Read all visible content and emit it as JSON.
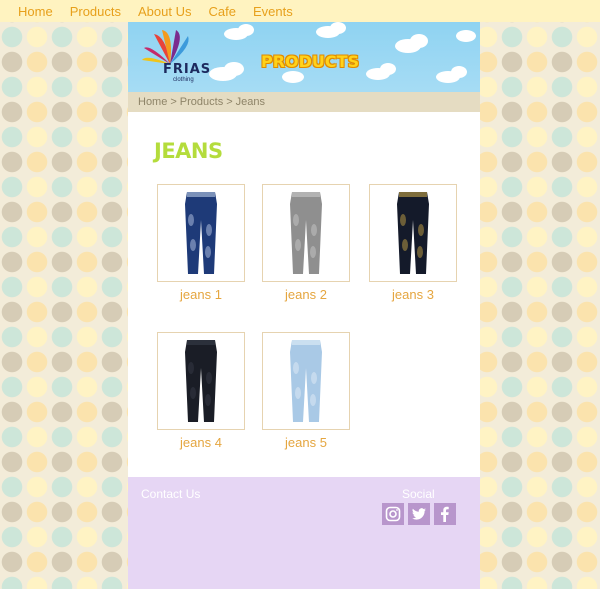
{
  "nav": [
    "Home",
    "Products",
    "About Us",
    "Cafe",
    "Events"
  ],
  "banner": {
    "logo_text": "FRIAS",
    "logo_sub": "clothing",
    "title": "PRODUCTS"
  },
  "breadcrumb": [
    "Home",
    "Products",
    "Jeans"
  ],
  "breadcrumb_separator": ">",
  "heading": "JEANS",
  "products": [
    {
      "label": "jeans 1",
      "jean_color": "#1e3a78",
      "accent": "#c9d8ef"
    },
    {
      "label": "jeans 2",
      "jean_color": "#8f8f8f",
      "accent": "#cfcfcf"
    },
    {
      "label": "jeans 3",
      "jean_color": "#141a2a",
      "accent": "#d6b24a"
    },
    {
      "label": "jeans 4",
      "jean_color": "#1a1d26",
      "accent": "#3a3f4c"
    },
    {
      "label": "jeans 5",
      "jean_color": "#a9c9e6",
      "accent": "#e6f0f8"
    }
  ],
  "footer": {
    "contact": "Contact Us",
    "social_title": "Social",
    "social_icons": [
      "instagram-icon",
      "twitter-icon",
      "facebook-icon"
    ]
  },
  "colors": {
    "nav_text": "#e7a01c",
    "heading": "#b4dc3c",
    "caption": "#e5a640",
    "footer_bg": "#e6d6f4",
    "social_icon_bg": "#b896cc"
  }
}
